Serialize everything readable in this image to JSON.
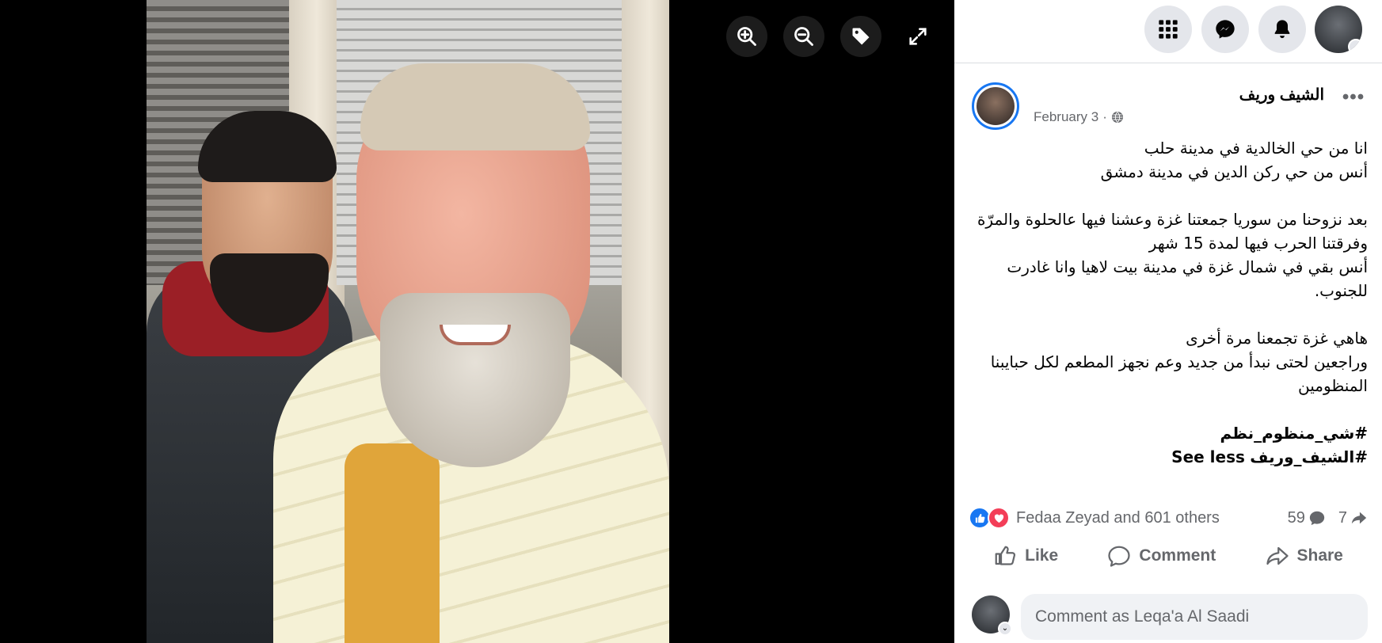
{
  "viewer": {
    "tools": [
      {
        "name": "zoom-in-icon"
      },
      {
        "name": "zoom-out-icon"
      },
      {
        "name": "tag-icon"
      },
      {
        "name": "fullscreen-icon"
      }
    ]
  },
  "topbar": {
    "icons": [
      "menu-grid-icon",
      "messenger-icon",
      "notifications-icon"
    ]
  },
  "post": {
    "author": "الشيف وريف",
    "date": "February 3",
    "separator": "·",
    "more": "•••",
    "lines": [
      "انا من حي الخالدية في مدينة حلب",
      "أنس من حي ركن الدين في مدينة دمشق",
      "",
      "بعد نزوحنا من سوريا جمعتنا غزة وعشنا فيها عالحلوة والمرّة وفرقتنا الحرب فيها لمدة 15 شهر",
      "أنس بقي في شمال غزة في مدينة بيت لاهيا وانا غادرت للجنوب.",
      "",
      "هاهي غزة تجمعنا مرة أخرى",
      "وراجعين لحتى نبدأ من جديد وعم نجهز المطعم لكل حبايبنا المنظومين"
    ],
    "hashtag_1": "#شي_منظوم_نظم",
    "hashtag_2": "#الشيف_وريف",
    "see_less": "See less"
  },
  "reactions": {
    "text": "Fedaa Zeyad and 601 others",
    "comments_count": "59",
    "shares_count": "7"
  },
  "actions": {
    "like": "Like",
    "comment": "Comment",
    "share": "Share"
  },
  "comment_box": {
    "placeholder": "Comment as Leqa'a Al Saadi"
  },
  "colors": {
    "accent": "#1877f2",
    "love": "#f33e58",
    "secondary_text": "#65676b"
  }
}
